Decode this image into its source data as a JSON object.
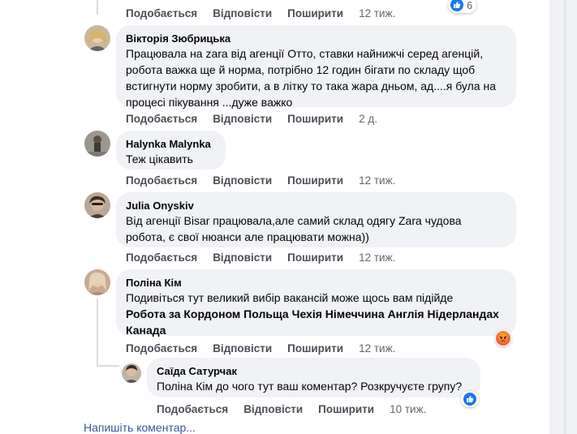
{
  "actions": {
    "like": "Подобається",
    "reply": "Відповісти",
    "share": "Поширити"
  },
  "top_row": {
    "time": "12 тиж.",
    "reaction_count": "6"
  },
  "comments": [
    {
      "author": "Вікторія Зюбрицька",
      "text": "Працювала на zara від агенції Отто, ставки найнижчі серед агенцій,\nробота важка ще й норма, потрібно 12 годин бігати по складу щоб\nвстигнути норму зробити, а в літку то така жара дньом, ад....я була на\nпроцесі пікування ...дуже важко",
      "time": "2 д."
    },
    {
      "author": "Halynka Malynka",
      "text": "Теж цікавить",
      "time": "12 тиж."
    },
    {
      "author": "Julia Onyskiv",
      "text": "Від агенції Bisar працювала,але самий склад одягу Zara чудова\nробота, є свої нюанси але працювати можна))",
      "time": "12 тиж."
    },
    {
      "author": "Поліна Кім",
      "text": "Подивіться тут великий вибір вакансій може щось вам підійде",
      "bold_text": "Робота за Кордоном Польща Чехія Німеччина Англія Нідерландах\nКанада",
      "time": "12 тиж."
    },
    {
      "author": "Саїда Сатурчак",
      "text": "Поліна Кім до чого тут ваш коментар? Розкручуєте групу?",
      "time": "10 тиж."
    }
  ],
  "write_comment": "Напишіть коментар..."
}
